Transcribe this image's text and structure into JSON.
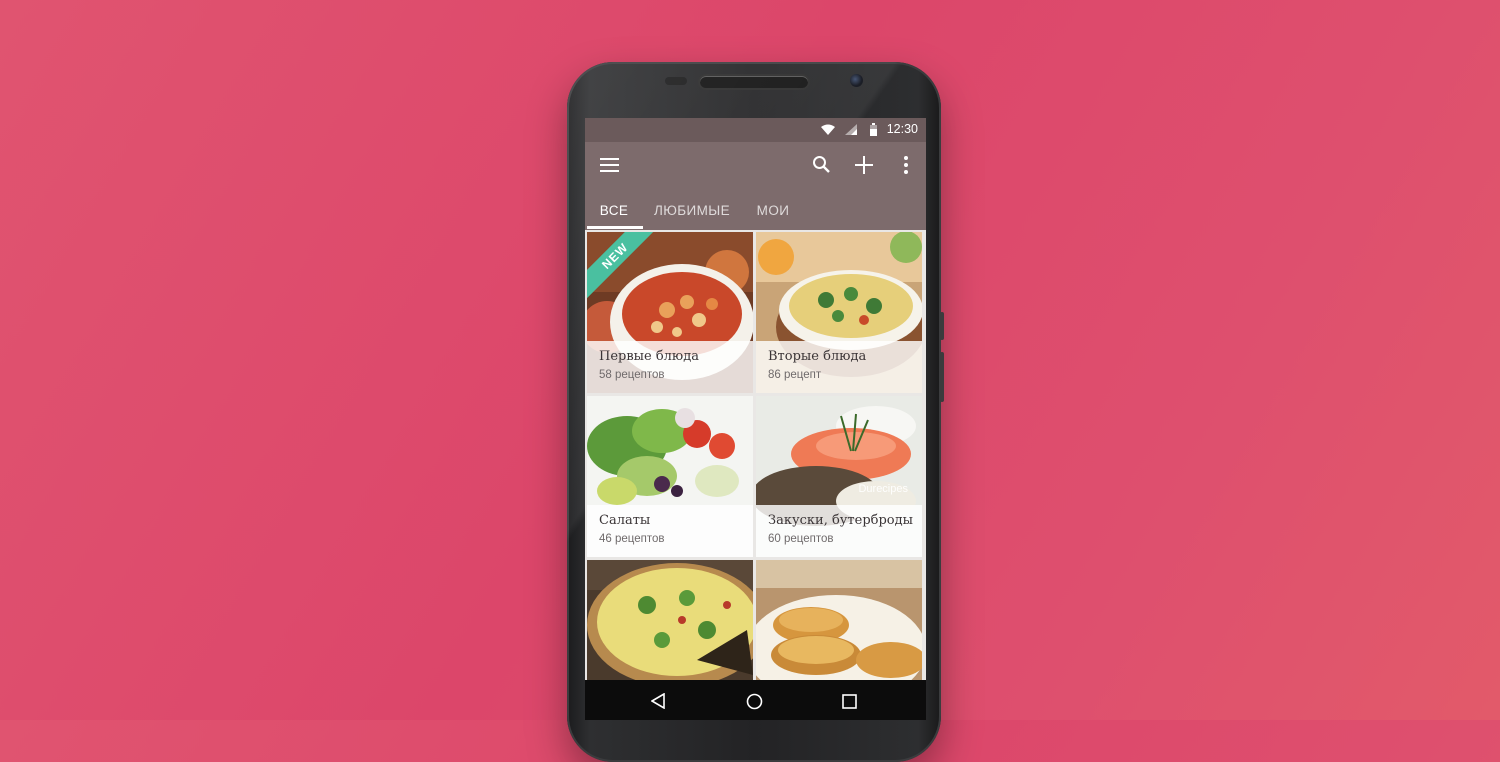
{
  "statusbar": {
    "time": "12:30"
  },
  "appbar": {
    "icons": [
      "menu-icon",
      "search-icon",
      "add-icon",
      "more-vert-icon"
    ],
    "tabs": [
      {
        "label": "ВСЕ",
        "active": true
      },
      {
        "label": "ЛЮБИМЫЕ",
        "active": false
      },
      {
        "label": "МОИ",
        "active": false
      }
    ]
  },
  "categories": [
    {
      "title": "Первые блюда",
      "count": "58 рецептов",
      "badge": "NEW"
    },
    {
      "title": "Вторые блюда",
      "count": "86 рецепт"
    },
    {
      "title": "Салаты",
      "count": "46 рецептов"
    },
    {
      "title": "Закуски, бутерброды",
      "count": "60 рецептов",
      "watermark": "Durecipes"
    },
    {
      "title": "",
      "count": ""
    },
    {
      "title": "",
      "count": ""
    }
  ],
  "fab": {
    "icon": "shuffle-icon"
  },
  "navbar": {
    "icons": [
      "back-icon",
      "home-icon",
      "recents-icon"
    ]
  },
  "colors": {
    "background": "#dc466a",
    "appbar": "#7d6b6c",
    "badge": "#4ac0a0",
    "fab": "#5a4a4b"
  }
}
